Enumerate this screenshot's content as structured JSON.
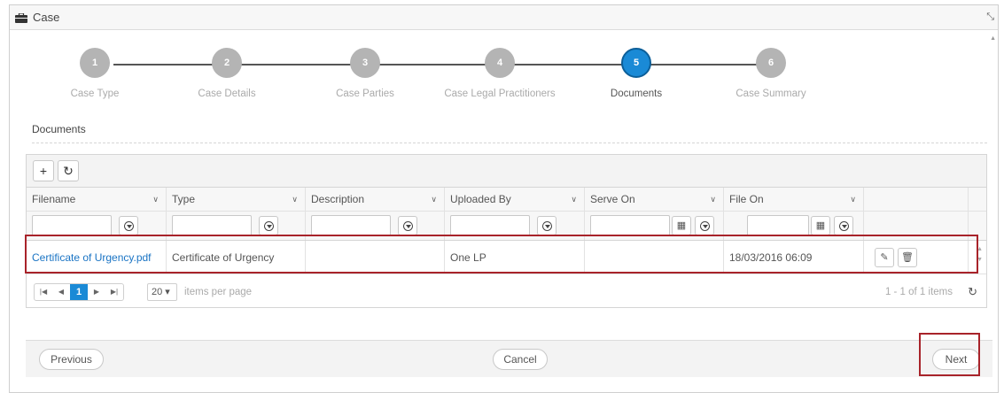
{
  "window": {
    "title": "Case"
  },
  "stepper": {
    "steps": [
      {
        "number": "1",
        "label": "Case Type"
      },
      {
        "number": "2",
        "label": "Case Details"
      },
      {
        "number": "3",
        "label": "Case Parties"
      },
      {
        "number": "4",
        "label": "Case Legal Practitioners"
      },
      {
        "number": "5",
        "label": "Documents",
        "active": true
      },
      {
        "number": "6",
        "label": "Case Summary"
      }
    ]
  },
  "section": {
    "title": "Documents"
  },
  "toolbar": {
    "add_label": "+",
    "reset_label": "↻"
  },
  "columns": [
    {
      "label": "Filename"
    },
    {
      "label": "Type"
    },
    {
      "label": "Description"
    },
    {
      "label": "Uploaded By"
    },
    {
      "label": "Serve On"
    },
    {
      "label": "File On"
    }
  ],
  "rows": [
    {
      "filename": "Certificate of Urgency.pdf",
      "type": "Certificate of Urgency",
      "description": "",
      "uploaded_by": "One LP",
      "serve_on": "",
      "file_on": "18/03/2016 06:09"
    }
  ],
  "pager": {
    "current_page": "1",
    "page_size": "20",
    "page_size_label": "items per page",
    "info": "1 - 1 of 1 items"
  },
  "footer": {
    "previous_label": "Previous",
    "cancel_label": "Cancel",
    "next_label": "Next"
  },
  "colors": {
    "accent": "#1a8ad6",
    "highlight": "#a8232a",
    "link": "#1a74c4"
  }
}
